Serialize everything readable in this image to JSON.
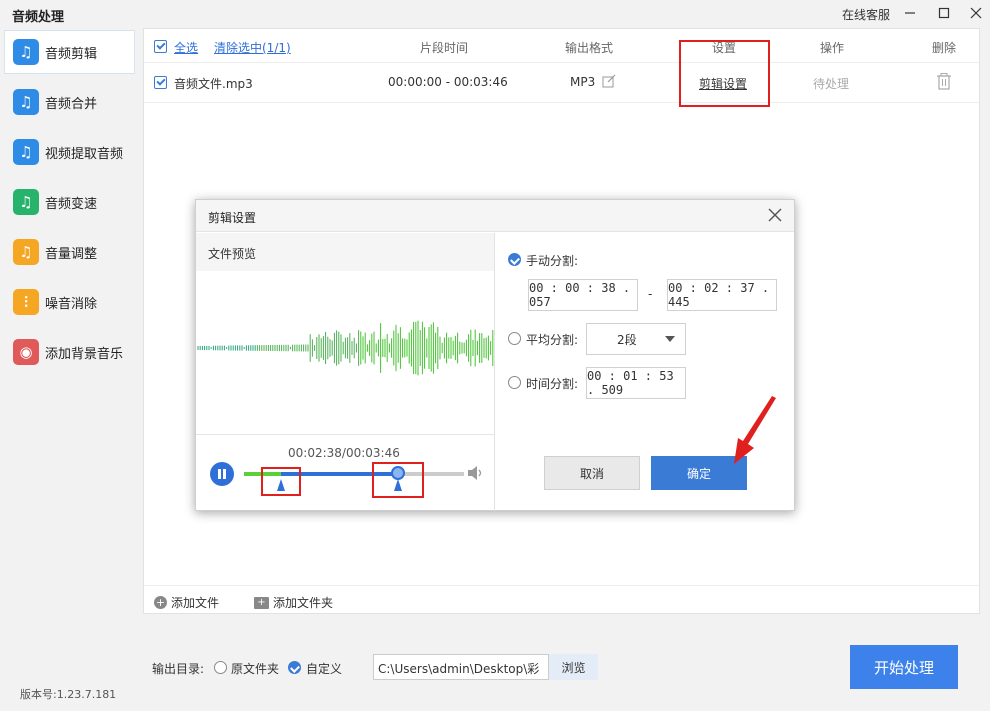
{
  "app": {
    "title": "音频处理",
    "online_service": "在线客服",
    "version": "版本号:1.23.7.181"
  },
  "sidebar": {
    "items": [
      {
        "label": "音频剪辑",
        "color": "#2e8be6",
        "glyph": "♫",
        "active": true
      },
      {
        "label": "音频合并",
        "color": "#2e8be6",
        "glyph": "♫"
      },
      {
        "label": "视频提取音频",
        "color": "#2e8be6",
        "glyph": "♫"
      },
      {
        "label": "音频变速",
        "color": "#27b36b",
        "glyph": "♫"
      },
      {
        "label": "音量调整",
        "color": "#f5a623",
        "glyph": "♫"
      },
      {
        "label": "噪音消除",
        "color": "#f5a623",
        "glyph": "⫶"
      },
      {
        "label": "添加背景音乐",
        "color": "#e05a5a",
        "glyph": "◉"
      }
    ]
  },
  "table": {
    "select_all": "全选",
    "clear_selected": "清除选中(1/1)",
    "columns": {
      "segment_time": "片段时间",
      "output_format": "输出格式",
      "settings": "设置",
      "operation": "操作",
      "delete": "删除"
    },
    "rows": [
      {
        "filename": "音频文件.mp3",
        "segment": "00:00:00 - 00:03:46",
        "format": "MP3",
        "settings_link": "剪辑设置",
        "status": "待处理"
      }
    ],
    "add_file": "添加文件",
    "add_folder": "添加文件夹"
  },
  "dialog": {
    "title": "剪辑设置",
    "preview_label": "文件预览",
    "playback_time": "00:02:38/00:03:46",
    "playback_fraction": 0.7,
    "trim_start_fraction": 0.17,
    "trim_end_fraction": 0.7,
    "manual_split": {
      "label": "手动分割:",
      "start": "00 : 00 : 38 . 057",
      "dash": "-",
      "end": "00 : 02 : 37 . 445"
    },
    "average_split": {
      "label": "平均分割:",
      "value": "2段"
    },
    "time_split": {
      "label": "时间分割:",
      "value": "00 : 01 : 53 . 509"
    },
    "cancel": "取消",
    "confirm": "确定"
  },
  "output": {
    "label": "输出目录:",
    "option_original": "原文件夹",
    "option_custom": "自定义",
    "path": "C:\\Users\\admin\\Desktop\\彩",
    "browse": "浏览",
    "start": "开始处理"
  },
  "colors": {
    "accent": "#3a7bd5",
    "start_button": "#3d82ea",
    "annotation": "#e0201f"
  }
}
